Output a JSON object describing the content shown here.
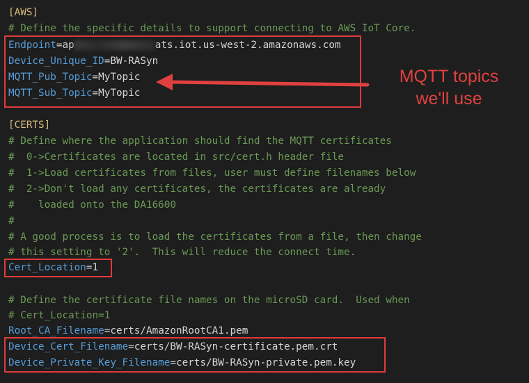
{
  "aws": {
    "section_header": "[AWS]",
    "comment": "# Define the specific details to support connecting to AWS IoT Core.",
    "endpoint_key": "Endpoint",
    "endpoint_value_prefix": "ap",
    "endpoint_value_suffix": "ats.iot.us-west-2.amazonaws.com",
    "device_id_key": "Device_Unique_ID",
    "device_id_value": "BW-RASyn",
    "pub_topic_key": "MQTT_Pub_Topic",
    "pub_topic_value": "MyTopic",
    "sub_topic_key": "MQTT_Sub_Topic",
    "sub_topic_value": "MyTopic"
  },
  "annotation": {
    "line1": "MQTT topics",
    "line2": "we'll use",
    "color": "#e0413f"
  },
  "certs": {
    "section_header": "[CERTS]",
    "comments": [
      "# Define where the application should find the MQTT certificates",
      "#  0->Certificates are located in src/cert.h header file",
      "#  1->Load certificates from files, user must define filenames below",
      "#  2->Don't load any certificates, the certificates are already",
      "#    loaded onto the DA16600",
      "#",
      "# A good process is to load the certificates from a file, then change",
      "# this setting to '2'.  This will reduce the connect time."
    ],
    "cert_location_key": "Cert_Location",
    "cert_location_value": "1",
    "file_comments": [
      "# Define the certificate file names on the microSD card.  Used when",
      "# Cert_Location=1"
    ],
    "root_ca_key": "Root_CA_Filename",
    "root_ca_value": "certs/AmazonRootCA1.pem",
    "device_cert_key": "Device_Cert_Filename",
    "device_cert_value": "certs/BW-RASyn-certificate.pem.crt",
    "private_key_key": "Device_Private_Key_Filename",
    "private_key_value": "certs/BW-RASyn-private.pem.key"
  },
  "colors": {
    "background": "#1e1e1e",
    "key": "#569cd6",
    "comment": "#6a9955",
    "section": "#d7ba7d",
    "highlight_box": "#e03a3a"
  }
}
